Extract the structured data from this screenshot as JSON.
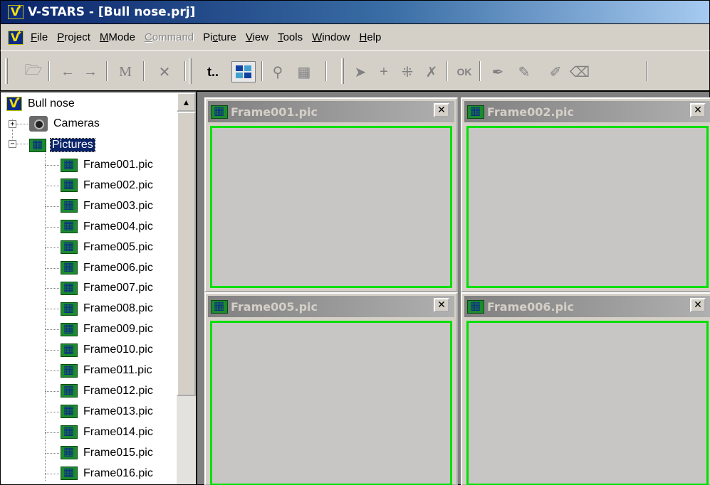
{
  "app": {
    "title": "V-STARS - [Bull nose.prj]"
  },
  "menubar": {
    "items": [
      {
        "u": "F",
        "rest": "ile",
        "disabled": false
      },
      {
        "u": "P",
        "rest": "roject",
        "disabled": false
      },
      {
        "u": "M",
        "rest": "Mode",
        "disabled": false
      },
      {
        "u": "C",
        "rest": "ommand",
        "disabled": true
      },
      {
        "pre": "Pi",
        "u": "c",
        "rest": "ture",
        "disabled": false
      },
      {
        "u": "V",
        "rest": "iew",
        "disabled": false
      },
      {
        "u": "T",
        "rest": "ools",
        "disabled": false
      },
      {
        "u": "W",
        "rest": "indow",
        "disabled": false
      },
      {
        "u": "H",
        "rest": "elp",
        "disabled": false
      }
    ]
  },
  "toolbar": {
    "tools": [
      "open-icon",
      "back-arrow-icon",
      "forward-arrow-icon",
      "measure-m-icon",
      "cancel-measure-icon",
      "target-t-icon",
      "picture-view-icon",
      "zoom-icon",
      "grid-icon",
      "pointer-icon",
      "crosshair-icon",
      "multi-crosshair-icon",
      "delete-point-icon",
      "ok-icon",
      "pen-icon",
      "pencil-icon",
      "edit-pen-icon",
      "eraser-icon"
    ],
    "ok_label": "OK",
    "m_label": "M"
  },
  "tree": {
    "root": "Bull nose",
    "cameras": "Cameras",
    "pictures": "Pictures",
    "frames": [
      "Frame001.pic",
      "Frame002.pic",
      "Frame003.pic",
      "Frame004.pic",
      "Frame005.pic",
      "Frame006.pic",
      "Frame007.pic",
      "Frame008.pic",
      "Frame009.pic",
      "Frame010.pic",
      "Frame011.pic",
      "Frame012.pic",
      "Frame013.pic",
      "Frame014.pic",
      "Frame015.pic",
      "Frame016.pic"
    ]
  },
  "windows": [
    {
      "title": "Frame001.pic"
    },
    {
      "title": "Frame002.pic"
    },
    {
      "title": "Frame005.pic"
    },
    {
      "title": "Frame006.pic"
    }
  ],
  "colors": {
    "view_border": "#00e000",
    "title_active": "#0a246a"
  }
}
